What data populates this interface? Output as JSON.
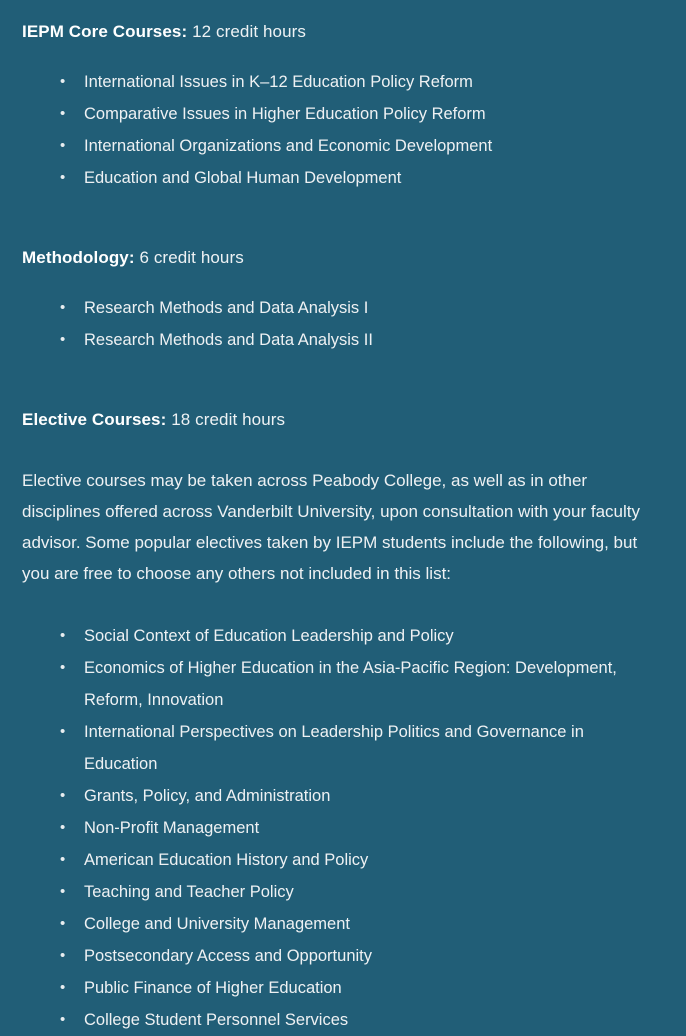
{
  "theme": {
    "background": "#215e77",
    "text": "#eef1f3",
    "heading_text": "#ffffff",
    "bullet": "#e8edef"
  },
  "sections": [
    {
      "heading_label": "IEPM Core Courses:",
      "heading_value": "12 credit hours",
      "courses": [
        "International Issues in K–12 Education Policy Reform",
        "Comparative Issues in Higher Education Policy Reform",
        "International Organizations and Economic Development",
        "Education and Global Human Development"
      ]
    },
    {
      "heading_label": "Methodology:",
      "heading_value": "6 credit hours",
      "courses": [
        "Research Methods and Data Analysis I",
        "Research Methods and Data Analysis II"
      ]
    },
    {
      "heading_label": "Elective Courses:",
      "heading_value": "18 credit hours",
      "paragraph": "Elective courses may be taken across Peabody College, as well as in other disciplines offered across Vanderbilt University, upon consultation with your faculty advisor. Some popular electives taken by IEPM students include the following, but you are free to choose any others not included in this list:",
      "courses": [
        "Social Context of Education Leadership and Policy",
        "Economics of Higher Education in the Asia-Pacific Region: Development, Reform, Innovation",
        "International Perspectives on Leadership Politics and Governance in Education",
        "Grants, Policy, and Administration",
        "Non-Profit Management",
        "American Education History and Policy",
        "Teaching and Teacher Policy",
        "College and University Management",
        "Postsecondary Access and Opportunity",
        "Public Finance of Higher Education",
        "College Student Personnel Services"
      ]
    }
  ]
}
